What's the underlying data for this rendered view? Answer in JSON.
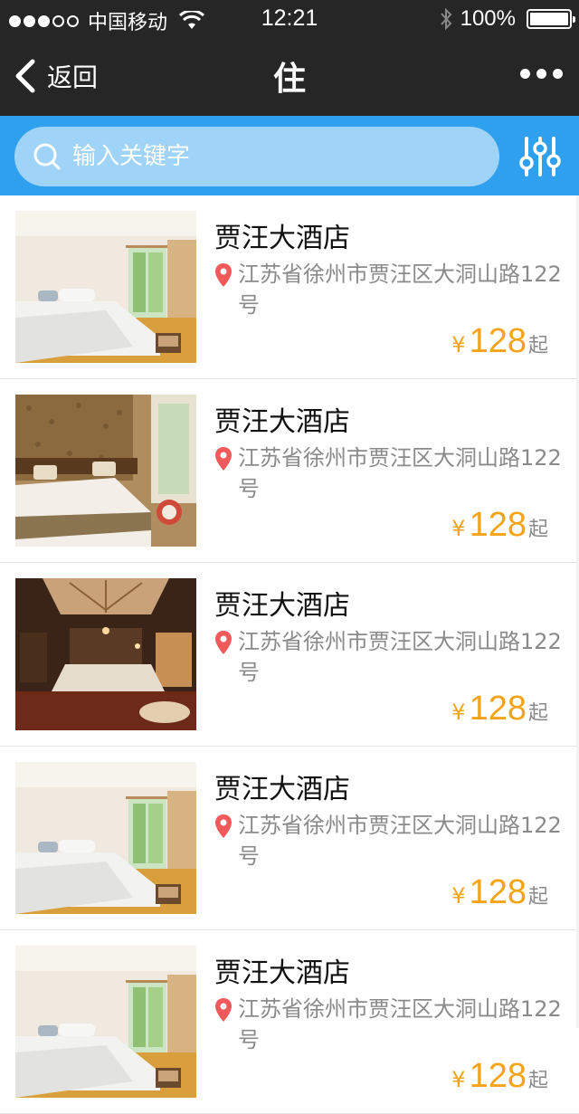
{
  "status_bar": {
    "carrier": "中国移动",
    "time": "12:21",
    "battery": "100%",
    "signal_bars_filled": 3,
    "signal_bars_total": 5,
    "battery_level": 1.0
  },
  "nav": {
    "back_label": "返回",
    "title": "住",
    "more_icon": "more-dots-icon"
  },
  "search": {
    "placeholder": "输入关键字",
    "search_icon": "search-icon",
    "filter_icon": "filter-sliders-icon"
  },
  "colors": {
    "header_bg": "#262626",
    "search_bar_bg": "#2ea0ee",
    "search_box_bg": "#9fd3f8",
    "price": "#f5a318",
    "pin": "#f05a5a"
  },
  "hotels": [
    {
      "name": "贾汪大酒店",
      "address": "江苏省徐州市贾汪区大洞山路122号",
      "currency": "¥",
      "price": "128",
      "price_suffix": "起",
      "image": "hotel-room-bright"
    },
    {
      "name": "贾汪大酒店",
      "address": "江苏省徐州市贾汪区大洞山路122号",
      "currency": "¥",
      "price": "128",
      "price_suffix": "起",
      "image": "hotel-room-brown"
    },
    {
      "name": "贾汪大酒店",
      "address": "江苏省徐州市贾汪区大洞山路122号",
      "currency": "¥",
      "price": "128",
      "price_suffix": "起",
      "image": "hotel-room-dark"
    },
    {
      "name": "贾汪大酒店",
      "address": "江苏省徐州市贾汪区大洞山路122号",
      "currency": "¥",
      "price": "128",
      "price_suffix": "起",
      "image": "hotel-room-bright"
    },
    {
      "name": "贾汪大酒店",
      "address": "江苏省徐州市贾汪区大洞山路122号",
      "currency": "¥",
      "price": "128",
      "price_suffix": "起",
      "image": "hotel-room-bright"
    }
  ]
}
